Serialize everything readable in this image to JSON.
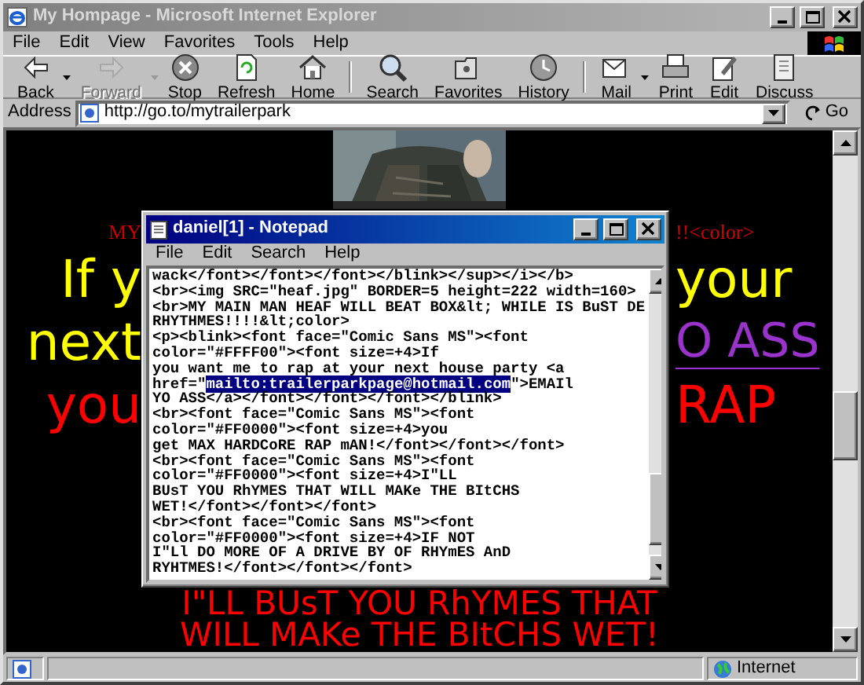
{
  "browser": {
    "title": "My Hompage - Microsoft Internet Explorer",
    "menu": [
      "File",
      "Edit",
      "View",
      "Favorites",
      "Tools",
      "Help"
    ],
    "toolbar": [
      [
        {
          "label": "Back",
          "disabled": false,
          "dropdown": true
        },
        {
          "label": "Forward",
          "disabled": true,
          "dropdown": true
        },
        {
          "label": "Stop",
          "disabled": false,
          "dropdown": false
        },
        {
          "label": "Refresh",
          "disabled": false,
          "dropdown": false
        },
        {
          "label": "Home",
          "disabled": false,
          "dropdown": false
        }
      ],
      [
        {
          "label": "Search",
          "disabled": false,
          "dropdown": false
        },
        {
          "label": "Favorites",
          "disabled": false,
          "dropdown": false
        },
        {
          "label": "History",
          "disabled": false,
          "dropdown": false
        }
      ],
      [
        {
          "label": "Mail",
          "disabled": false,
          "dropdown": true
        },
        {
          "label": "Print",
          "disabled": false,
          "dropdown": false
        },
        {
          "label": "Edit",
          "disabled": false,
          "dropdown": false
        },
        {
          "label": "Discuss",
          "disabled": false,
          "dropdown": false
        }
      ]
    ],
    "address": {
      "label": "Address",
      "value": "http://go.to/mytrailerpark",
      "go": "Go"
    },
    "page": {
      "rows": [
        {
          "kind": "caption",
          "left": {
            "text": "MY",
            "color": "#cc0000",
            "link": false
          },
          "right": {
            "text": "!!<color>",
            "color": "#cc0000",
            "link": false
          }
        },
        {
          "kind": "heading",
          "left": {
            "text": "If y",
            "color": "#ffff00",
            "link": false
          },
          "right": {
            "text": "your",
            "color": "#ffff00",
            "link": false
          }
        },
        {
          "kind": "heading",
          "left": {
            "text": "next",
            "color": "#ffff00",
            "link": false
          },
          "right": {
            "text": "O ASS",
            "color": "#9933cc",
            "link": true
          }
        },
        {
          "kind": "heading",
          "left": {
            "text": "you",
            "color": "#ff0000",
            "link": false
          },
          "right": {
            "text": "RAP",
            "color": "#ff0000",
            "link": false
          }
        }
      ],
      "lines": [
        {
          "text": "I\"LL BUsT YOU RhYMES THAT",
          "color": "#ff0000"
        },
        {
          "text": "WILL MAKe THE BItCHS WET!",
          "color": "#ff0000"
        }
      ]
    },
    "status": {
      "zone": "Internet"
    }
  },
  "notepad": {
    "title": "daniel[1] - Notepad",
    "menu": [
      "File",
      "Edit",
      "Search",
      "Help"
    ],
    "lines": [
      [
        {
          "text": "wack</font></font></font></blink></sup></i></b>",
          "selected": false
        }
      ],
      [
        {
          "text": "<br><img SRC=\"heaf.jpg\" BORDER=5 height=222 width=160>",
          "selected": false
        }
      ],
      [
        {
          "text": "<br>MY MAIN MAN HEAF WILL BEAT BOX&lt; WHILE IS BuST DE",
          "selected": false
        }
      ],
      [
        {
          "text": "RHYTHMES!!!!&lt;color>",
          "selected": false
        }
      ],
      [
        {
          "text": "<p><blink><font face=\"Comic Sans MS\"><font",
          "selected": false
        }
      ],
      [
        {
          "text": "color=\"#FFFF00\"><font size=+4>If",
          "selected": false
        }
      ],
      [
        {
          "text": "you want me to rap at your next house party <a",
          "selected": false
        }
      ],
      [
        {
          "text": "href=\"",
          "selected": false
        },
        {
          "text": "mailto:trailerparkpage@hotmail.com",
          "selected": true
        },
        {
          "text": "\">EMAIl",
          "selected": false
        }
      ],
      [
        {
          "text": "YO ASS</a></font></font></font></blink>",
          "selected": false
        }
      ],
      [
        {
          "text": "<br><font face=\"Comic Sans MS\"><font",
          "selected": false
        }
      ],
      [
        {
          "text": "color=\"#FF0000\"><font size=+4>you",
          "selected": false
        }
      ],
      [
        {
          "text": "get MAX HARDCoRE RAP mAN!</font></font></font>",
          "selected": false
        }
      ],
      [
        {
          "text": "<br><font face=\"Comic Sans MS\"><font",
          "selected": false
        }
      ],
      [
        {
          "text": "color=\"#FF0000\"><font size=+4>I\"LL",
          "selected": false
        }
      ],
      [
        {
          "text": "BUsT YOU RhYMES THAT WILL MAKe THE BItCHS",
          "selected": false
        }
      ],
      [
        {
          "text": "WET!</font></font></font>",
          "selected": false
        }
      ],
      [
        {
          "text": "<br><font face=\"Comic Sans MS\"><font",
          "selected": false
        }
      ],
      [
        {
          "text": "color=\"#FF0000\"><font size=+4>IF NOT",
          "selected": false
        }
      ],
      [
        {
          "text": "I\"Ll DO MORE OF A DRIVE BY OF RHYmES AnD",
          "selected": false
        }
      ],
      [
        {
          "text": "RYHTMES!</font></font></font>",
          "selected": false
        }
      ]
    ]
  }
}
